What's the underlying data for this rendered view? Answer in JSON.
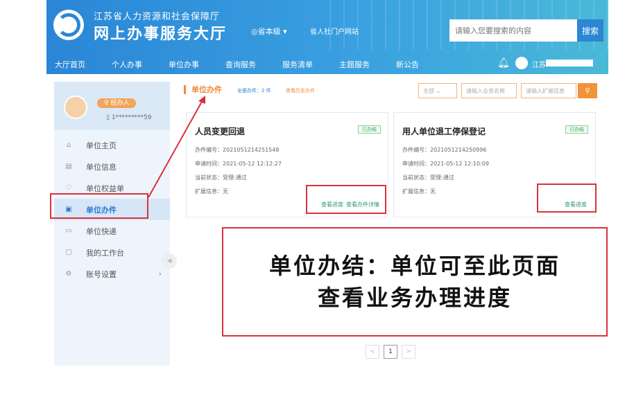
{
  "header": {
    "org_name": "江苏省人力资源和社会保障厅",
    "hall_name": "网上办事服务大厅",
    "region": "◎省本级 ▾",
    "portal": "省人社门户网站",
    "search_placeholder": "请输入您要搜索的内容",
    "search_button": "搜索"
  },
  "nav": {
    "items": [
      "大厅首页",
      "个人办事",
      "单位办事",
      "查询服务",
      "服务清单",
      "主题服务",
      "新公告"
    ],
    "user_name": "江苏"
  },
  "sidebar": {
    "role": "♀ 经办人",
    "phone": "1*********59",
    "items": [
      {
        "label": "单位主页",
        "icon": "home-icon"
      },
      {
        "label": "单位信息",
        "icon": "info-icon"
      },
      {
        "label": "单位权益单",
        "icon": "shield-icon"
      },
      {
        "label": "单位办件",
        "icon": "case-icon"
      },
      {
        "label": "单位快递",
        "icon": "express-icon"
      },
      {
        "label": "我的工作台",
        "icon": "workbench-icon"
      },
      {
        "label": "账号设置",
        "icon": "settings-icon"
      }
    ]
  },
  "main": {
    "section_title": "单位办件",
    "all_count": "全部办件：2 件",
    "history_link": "查看历史办件",
    "filters": {
      "all": "全部 ⌄",
      "biz_name": "请输入业务名称",
      "ext_info": "请输入扩展信息"
    },
    "cards": [
      {
        "title": "人员变更回退",
        "badge": "已办结",
        "number": "办件编号：2021051214251548",
        "apply_time": "申请时间：2021-05-12 12:12:27",
        "status": "当前状态：受理:通过",
        "ext": "扩展信息：无",
        "link_progress": "查看进度",
        "link_detail": "查看办件详情"
      },
      {
        "title": "用人单位退工停保登记",
        "badge": "已办结",
        "number": "办件编号：2021051214250996",
        "apply_time": "申请时间：2021-05-12 12:10:09",
        "status": "当前状态：受理:通过",
        "ext": "扩展信息：无",
        "link_progress": "查看进度"
      }
    ],
    "annotation": [
      "单位办结：单位可至此页面",
      "查看业务办理进度"
    ],
    "pager": {
      "prev": "<",
      "current": "1",
      "next": ">"
    }
  },
  "colors": {
    "accent": "#f08a3c",
    "primary": "#2a86d6",
    "annotation_red": "#d9313a"
  }
}
